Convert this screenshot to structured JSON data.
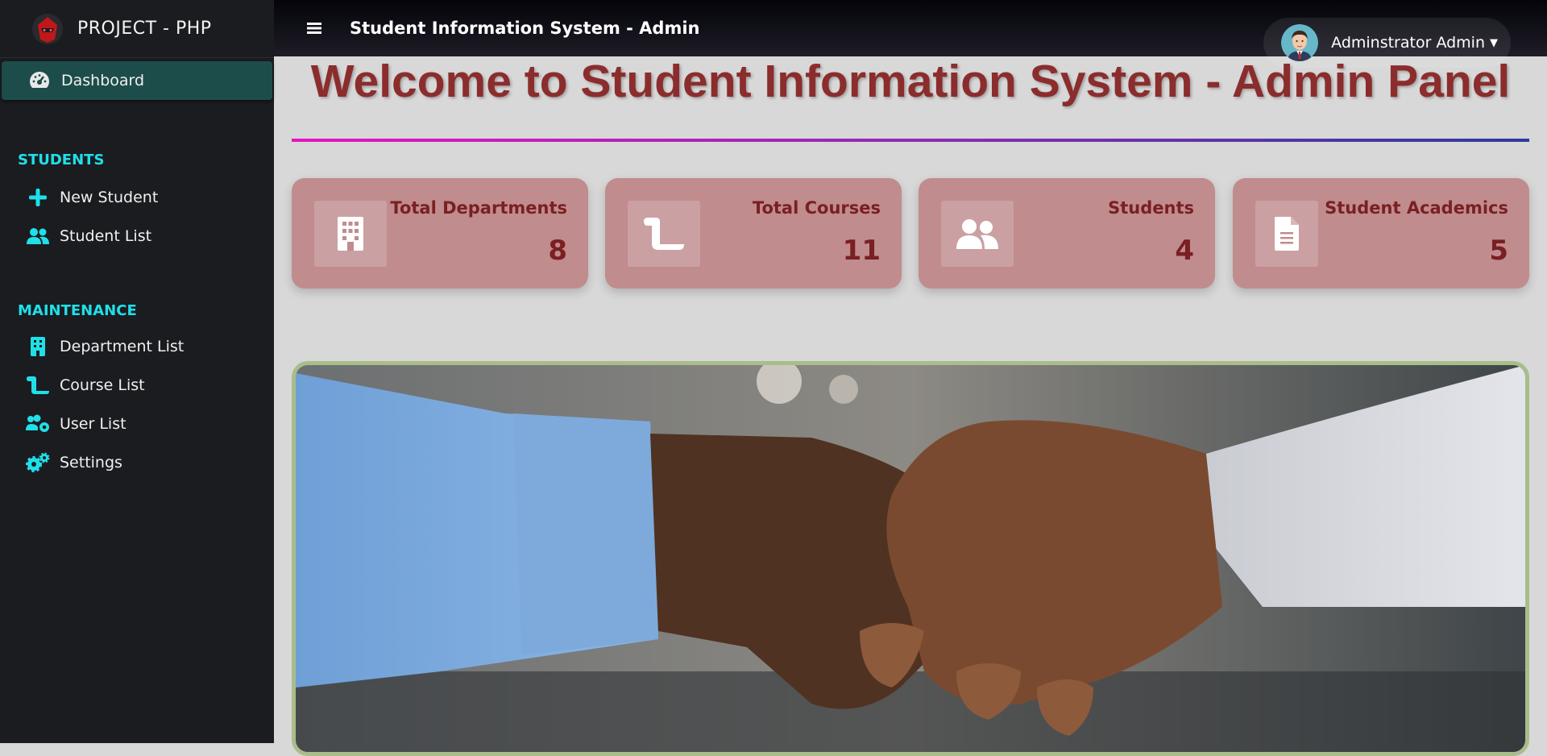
{
  "sidebar": {
    "brand": "PROJECT - PHP",
    "dashboard": "Dashboard",
    "students_header": "STUDENTS",
    "new_student": "New Student",
    "student_list": "Student List",
    "maintenance_header": "MAINTENANCE",
    "department_list": "Department List",
    "course_list": "Course List",
    "user_list": "User List",
    "settings": "Settings"
  },
  "topbar": {
    "title": "Student Information System - Admin",
    "user": "Adminstrator Admin"
  },
  "main": {
    "welcome": "Welcome to Student Information System - Admin Panel",
    "cards": [
      {
        "label": "Total Departments",
        "value": "8",
        "icon": "building-icon"
      },
      {
        "label": "Total Courses",
        "value": "11",
        "icon": "scroll-icon"
      },
      {
        "label": "Students",
        "value": "4",
        "icon": "user-group-icon"
      },
      {
        "label": "Student Academics",
        "value": "5",
        "icon": "document-icon"
      }
    ],
    "banner_icon": "handshake-image"
  },
  "colors": {
    "accent_cyan": "#1fe0e8",
    "card_bg": "#c08c8e",
    "card_text": "#7a1f22",
    "welcome_text": "#8b2d2d"
  }
}
